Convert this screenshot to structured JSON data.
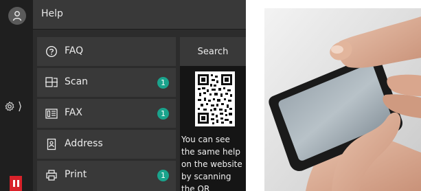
{
  "header": {
    "title": "Help"
  },
  "sidebar": {
    "icons": [
      "user-icon",
      "settings-icon",
      "pause-icon"
    ],
    "settings_chevron": "⟩"
  },
  "menu": {
    "items": [
      {
        "label": "FAQ",
        "icon": "question-circle-icon",
        "badge": ""
      },
      {
        "label": "Scan",
        "icon": "scan-icon",
        "badge": "1"
      },
      {
        "label": "FAX",
        "icon": "fax-icon",
        "badge": "1"
      },
      {
        "label": "Address",
        "icon": "address-book-icon",
        "badge": ""
      },
      {
        "label": "Print",
        "icon": "print-icon",
        "badge": "1"
      }
    ]
  },
  "help_panel": {
    "search_label": "Search",
    "text": "You can see the same help on the website by scanning the QR"
  },
  "colors": {
    "panel_bg": "#2c2c2c",
    "item_bg": "#393939",
    "badge": "#1aa38c",
    "pause_button": "#d8222a"
  }
}
